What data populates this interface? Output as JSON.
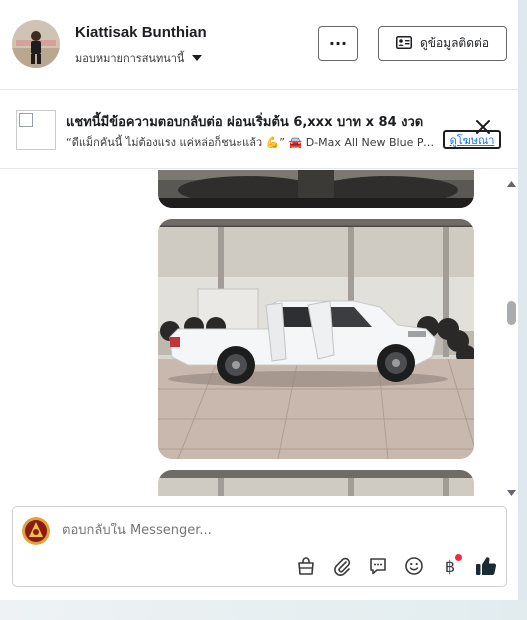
{
  "header": {
    "name": "Kiattisak Bunthian",
    "subtitle": "มอบหมายการสนทนานี้",
    "more_label": "···",
    "contact_label": "ดูข้อมูลติดต่อ"
  },
  "ad": {
    "title": "แชทนี้มีข้อความตอบกลับต่อ ผ่อนเริ่มต้น 6,xxx บาท x 84 งวด",
    "description": "“ดีแม็กคันนี้ ไม่ต้องแรง แค่หล่อก็ชนะแล้ว 💪” 🚘 D-Max All New Blue Power Spacecab",
    "link_label": "ดูโฆษณา"
  },
  "composer": {
    "placeholder": "ตอบกลับใน Messenger...",
    "tools": [
      "shopping-bag-icon",
      "paperclip-icon",
      "chat-bubble-icon",
      "smiley-icon",
      "baht-icon",
      "thumbs-up-icon"
    ],
    "baht_symbol": "฿"
  },
  "colors": {
    "accent": "#1877f2",
    "notification": "#f02849",
    "car": "#f5f6f7"
  }
}
